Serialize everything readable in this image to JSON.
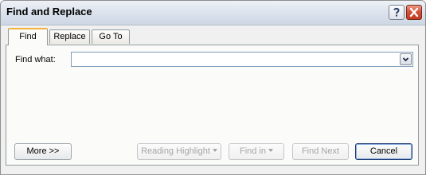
{
  "window": {
    "title": "Find and Replace",
    "help_icon": "question-mark-icon",
    "close_icon": "close-x-icon",
    "close_color": "#c33a22"
  },
  "tabs": [
    {
      "label": "Find",
      "active": true
    },
    {
      "label": "Replace",
      "active": false
    },
    {
      "label": "Go To",
      "active": false
    }
  ],
  "find": {
    "label": "Find what:",
    "value": "",
    "dropdown_icon": "chevron-down-icon"
  },
  "buttons": {
    "more": "More >>",
    "reading_highlight": "Reading Highlight",
    "find_in": "Find in",
    "find_next": "Find Next",
    "cancel": "Cancel"
  },
  "colors": {
    "active_tab_accent": "#f4b23d",
    "disabled_text": "#a5a5a5"
  }
}
